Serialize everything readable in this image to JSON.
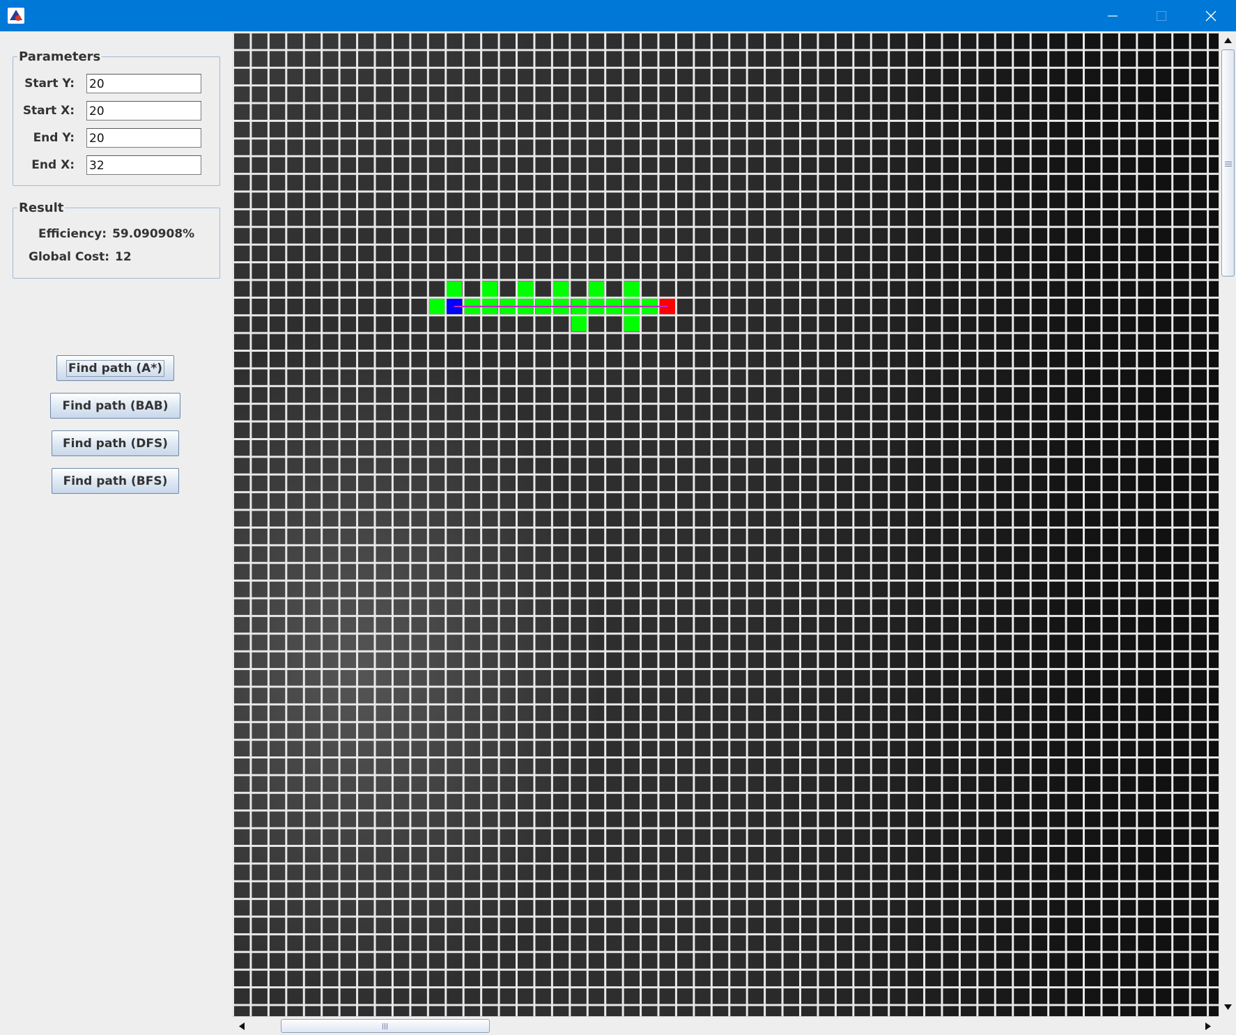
{
  "window": {
    "title": "",
    "controls": {
      "minimize_icon": "minimize-icon",
      "maximize_icon": "maximize-icon",
      "close_icon": "close-icon"
    },
    "titlebar_color": "#0078d7"
  },
  "parameters": {
    "legend": "Parameters",
    "fields": [
      {
        "label": "Start Y:",
        "value": "20"
      },
      {
        "label": "Start X:",
        "value": "20"
      },
      {
        "label": "End Y:",
        "value": "20"
      },
      {
        "label": "End X:",
        "value": "32"
      }
    ]
  },
  "result": {
    "legend": "Result",
    "efficiency_label": "Efficiency:",
    "efficiency_value": "59.090908%",
    "global_cost_label": "Global Cost:",
    "global_cost_value": "12"
  },
  "buttons": {
    "astar": "Find path (A*)",
    "bab": "Find path (BAB)",
    "dfs": "Find path (DFS)",
    "bfs": "Find path (BFS)"
  },
  "grid": {
    "visible_cols": 56,
    "visible_rows": 56,
    "start_cell": {
      "col": 12,
      "row": 15
    },
    "end_cell": {
      "col": 24,
      "row": 15
    },
    "explored_cells": [
      [
        12,
        14
      ],
      [
        14,
        14
      ],
      [
        16,
        14
      ],
      [
        18,
        14
      ],
      [
        20,
        14
      ],
      [
        22,
        14
      ],
      [
        11,
        15
      ],
      [
        13,
        15
      ],
      [
        14,
        15
      ],
      [
        15,
        15
      ],
      [
        16,
        15
      ],
      [
        17,
        15
      ],
      [
        18,
        15
      ],
      [
        19,
        15
      ],
      [
        20,
        15
      ],
      [
        21,
        15
      ],
      [
        22,
        15
      ],
      [
        23,
        15
      ],
      [
        19,
        16
      ],
      [
        22,
        16
      ]
    ],
    "colors": {
      "explored": "#00ff00",
      "start": "#0000ff",
      "end": "#ff0000",
      "path": "#cc22cc",
      "grid_line": "#e8e8e8"
    }
  }
}
